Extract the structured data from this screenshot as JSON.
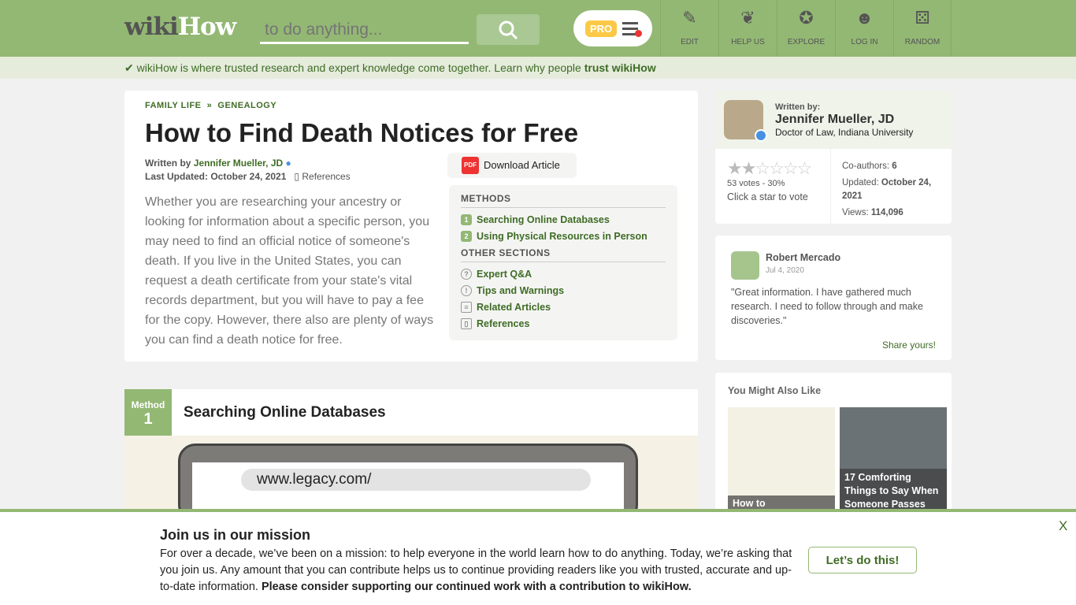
{
  "header": {
    "logo_wiki": "wiki",
    "logo_how": "How",
    "search_placeholder": "to do anything...",
    "pro_label": "PRO",
    "nav": [
      {
        "label": "EDIT",
        "icon": "✎"
      },
      {
        "label": "HELP US",
        "icon": "❦"
      },
      {
        "label": "EXPLORE",
        "icon": "✪"
      },
      {
        "label": "LOG IN",
        "icon": "☻"
      },
      {
        "label": "RANDOM",
        "icon": "⚄"
      }
    ]
  },
  "trust_bar": {
    "text": "wikiHow is where trusted research and expert knowledge come together. Learn why people ",
    "link": "trust wikiHow"
  },
  "article": {
    "breadcrumb": [
      "FAMILY LIFE",
      "GENEALOGY"
    ],
    "separator": "»",
    "title": "How to Find Death Notices for Free",
    "written_by_label": "Written by ",
    "author": "Jennifer Mueller, JD",
    "last_updated": "Last Updated: October 24, 2021",
    "references_label": "References",
    "download_label": "Download Article",
    "pdf_label": "PDF",
    "intro": "Whether you are researching your ancestry or looking for information about a specific person, you may need to find an official notice of someone's death. If you live in the United States, you can request a death certificate from your state's vital records department, but you will have to pay a fee for the copy. However, there also are plenty of ways you can find a death notice for free.",
    "toc": {
      "methods_title": "METHODS",
      "methods": [
        "Searching Online Databases",
        "Using Physical Resources in Person"
      ],
      "other_title": "OTHER SECTIONS",
      "other": [
        {
          "label": "Expert Q&A",
          "icon": "?"
        },
        {
          "label": "Tips and Warnings",
          "icon": "!"
        },
        {
          "label": "Related Articles",
          "icon": "≡"
        },
        {
          "label": "References",
          "icon": "▯"
        }
      ]
    }
  },
  "method": {
    "label": "Method",
    "number": "1",
    "title": "Searching Online Databases",
    "image_url_text": "www.legacy.com/"
  },
  "sidebar": {
    "written_by": "Written by:",
    "author": "Jennifer Mueller, JD",
    "credentials": "Doctor of Law, Indiana University",
    "rating": 1.5,
    "rating_max": 5,
    "votes": "53 votes - 30%",
    "vote_prompt": "Click a star to vote",
    "coauthors_label": "Co-authors: ",
    "coauthors": "6",
    "updated_label": "Updated: ",
    "updated": "October 24, 2021",
    "views_label": "Views: ",
    "views": "114,096",
    "review": {
      "name": "Robert Mercado",
      "date": "Jul 4, 2020",
      "text": "\"Great information. I have gathered much research. I need to follow through and make discoveries.\"",
      "share": "Share yours!"
    },
    "also_like": {
      "title": "You Might Also Like",
      "items": [
        "How to",
        "17 Comforting Things to Say When Someone Passes"
      ]
    }
  },
  "banner": {
    "title": "Join us in our mission",
    "text": "For over a decade, we’ve been on a mission: to help everyone in the world learn how to do anything. Today, we’re asking that you join us. Any amount that you can contribute helps us to continue providing readers like you with trusted, accurate and up-to-date information. ",
    "bold": "Please consider supporting our continued work with a contribution to wikiHow.",
    "cta": "Let’s do this!",
    "close": "X"
  },
  "colors": {
    "brand": "#93b874",
    "link": "#3f6c25"
  }
}
